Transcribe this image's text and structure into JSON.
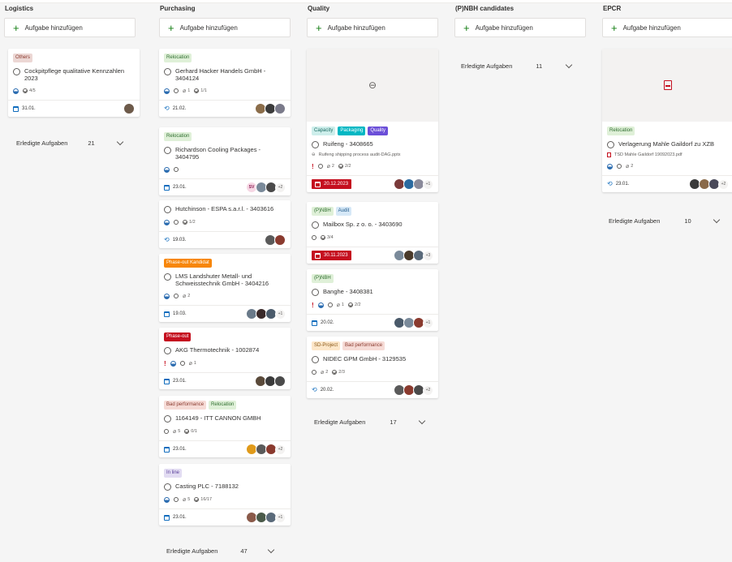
{
  "add_task_label": "Aufgabe hinzufügen",
  "done_label": "Erledigte Aufgaben",
  "colors": {
    "green": "#107c10",
    "overdue": "#c50f1f",
    "accent": "#0f6cbd"
  },
  "columns": [
    {
      "title": "Logistics",
      "done_count": "21",
      "cards": [
        {
          "tags": [
            {
              "label": "Others",
              "bg": "#ecd7d4",
              "fg": "#8a3a2e"
            }
          ],
          "title": "Cockpitpflege qualitative Kennzahlen 2023",
          "checklist": "4/5",
          "date": "31.01.",
          "avatars": [
            "#6d5a4a"
          ]
        }
      ]
    },
    {
      "title": "Purchasing",
      "done_count": "47",
      "cards": [
        {
          "tags": [
            {
              "label": "Relocation",
              "bg": "#dff0d8",
              "fg": "#2f6e2f"
            }
          ],
          "title": "Gerhard Hacker Handels GmbH - 3404124",
          "attachments": "1",
          "checklist": "1/1",
          "date": "21.02.",
          "avatars": [
            "#8b6d4a",
            "#3b3b3b",
            "#7a7a8a"
          ]
        },
        {
          "tags": [
            {
              "label": "Relocation",
              "bg": "#dff0d8",
              "fg": "#2f6e2f"
            }
          ],
          "title": "Richardson Cooling Packages - 3404795",
          "date": "23.01.",
          "initials": "SV",
          "avatars": [
            "#7a8a9a",
            "#4a4a4a"
          ],
          "more": "+2"
        },
        {
          "title": "Hutchinson - ESPA s.a.r.l. - 3403616",
          "checklist": "1/2",
          "date": "19.03.",
          "avatars": [
            "#5a5a5a",
            "#8a3a2e"
          ]
        },
        {
          "tags": [
            {
              "label": "Phase-out Kandidat",
              "bg": "#f7860a",
              "fg": "#ffffff"
            }
          ],
          "title": "LMS Landshuter Metall- und Schweisstechnik GmbH - 3404216",
          "attachments": "2",
          "date": "19.03.",
          "avatars": [
            "#6a7a8a",
            "#3a2a2a",
            "#4a5a6a"
          ],
          "more": "+1"
        },
        {
          "tags": [
            {
              "label": "Phase-out",
              "bg": "#c50f1f",
              "fg": "#ffffff"
            }
          ],
          "title": "AKG Thermotechnik - 1002874",
          "attachments": "1",
          "date": "23.01.",
          "avatars": [
            "#5a4a3a",
            "#3a3a3a",
            "#4a4a4a"
          ]
        },
        {
          "tags": [
            {
              "label": "Bad performance",
              "bg": "#f6dbd6",
              "fg": "#8a3a2e"
            },
            {
              "label": "Relocation",
              "bg": "#dff0d8",
              "fg": "#2f6e2f"
            }
          ],
          "title": "1164149 - ITT CANNON GMBH",
          "attachments": "5",
          "checklist": "0/1",
          "date": "23.01.",
          "avatars": [
            "#e09a1a",
            "#5a5a5a",
            "#8a3a2e"
          ],
          "more": "+2"
        },
        {
          "tags": [
            {
              "label": "In line",
              "bg": "#e2dcf2",
              "fg": "#5a3e9a"
            }
          ],
          "title": "Casting PLC - 7188132",
          "attachments": "5",
          "checklist": "16/17",
          "date": "23.01.",
          "avatars": [
            "#8a5a4a",
            "#4a5a4a",
            "#5a6a7a"
          ],
          "more": "+1"
        }
      ]
    },
    {
      "title": "Quality",
      "done_count": "17",
      "cards": [
        {
          "tags": [
            {
              "label": "Capacity",
              "bg": "#cdeeeb",
              "fg": "#1b6b63"
            },
            {
              "label": "Packaging",
              "bg": "#00b7c3",
              "fg": "#ffffff"
            },
            {
              "label": "Quality",
              "bg": "#6b4fd8",
              "fg": "#ffffff"
            }
          ],
          "title": "Ruifeng - 3408665",
          "attachment_name": "Ruifeng shipping process audit-DAG.pptx",
          "attachments": "2",
          "checklist": "2/2",
          "date": "20.12.2023",
          "avatars": [
            "#7a3a3a",
            "#2a6aa0",
            "#8a8a9a"
          ],
          "more": "+1"
        },
        {
          "tags": [
            {
              "label": "(P)NBH",
              "bg": "#dff0d8",
              "fg": "#2f6e2f"
            },
            {
              "label": "Audit",
              "bg": "#d6e8f7",
              "fg": "#1f5a8a"
            }
          ],
          "title": "Mailbox Sp. z o. o. - 3403690",
          "checklist": "3/4",
          "date": "30.11.2023",
          "avatars": [
            "#7a8a9a",
            "#4a3a2a",
            "#5a6a7a"
          ],
          "more": "+3"
        },
        {
          "tags": [
            {
              "label": "(P)NBH",
              "bg": "#dff0d8",
              "fg": "#2f6e2f"
            }
          ],
          "title": "Banghe - 3408381",
          "attachments": "1",
          "checklist": "2/2",
          "date": "20.02.",
          "avatars": [
            "#4a5a6a",
            "#7a8a9a",
            "#8a3a2e"
          ],
          "more": "+1"
        },
        {
          "tags": [
            {
              "label": "SD-Project",
              "bg": "#fde7c9",
              "fg": "#8a5a1a"
            },
            {
              "label": "Bad performance",
              "bg": "#f6dbd6",
              "fg": "#8a3a2e"
            }
          ],
          "title": "NIDEC GPM GmbH - 3129535",
          "attachments": "2",
          "checklist": "2/3",
          "date": "20.02.",
          "avatars": [
            "#5a5a5a",
            "#8a3a2e",
            "#4a4a4a"
          ],
          "more": "+2"
        }
      ]
    },
    {
      "title": "(P)NBH candidates",
      "done_count": "11",
      "cards": []
    },
    {
      "title": "EPCR",
      "done_count": "10",
      "cards": [
        {
          "tags": [
            {
              "label": "Relocation",
              "bg": "#dff0d8",
              "fg": "#2f6e2f"
            }
          ],
          "title": "Verlagerung Mahle Gaildorf zu XZB",
          "attachment_name": "TSD Mahle Gaildorf 19092023.pdf",
          "attachments": "2",
          "date": "23.01.",
          "avatars": [
            "#3a3a3a",
            "#8a6a4a",
            "#4a4a5a"
          ],
          "more": "+2"
        }
      ]
    }
  ]
}
